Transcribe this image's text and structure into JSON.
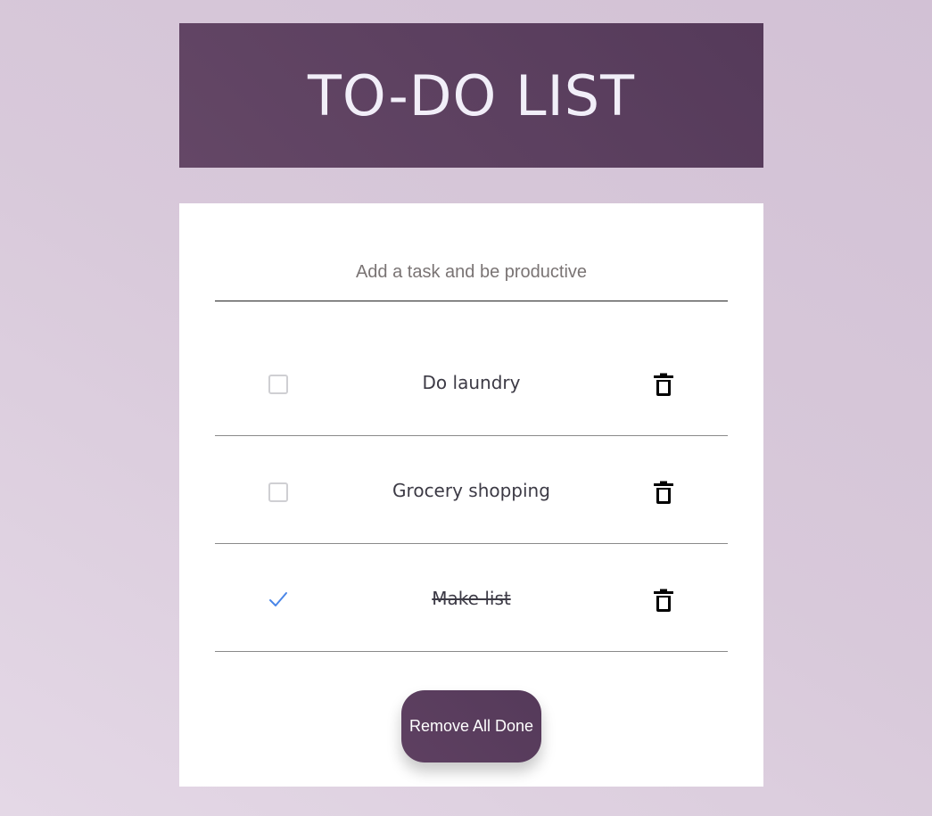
{
  "header": {
    "title": "TO-DO LIST"
  },
  "input": {
    "placeholder": "Add a task and be productive",
    "value": ""
  },
  "tasks": [
    {
      "text": "Do laundry",
      "done": false
    },
    {
      "text": "Grocery shopping",
      "done": false
    },
    {
      "text": "Make list",
      "done": true
    }
  ],
  "actions": {
    "remove_all_done_label": "Remove All Done"
  },
  "icons": {
    "checkbox": "checkbox-icon",
    "checkmark": "checkmark-icon",
    "delete": "trash-icon"
  },
  "colors": {
    "accent": "#5a3d5e",
    "checkmark": "#4a86e8",
    "background": "#dccfdf"
  }
}
